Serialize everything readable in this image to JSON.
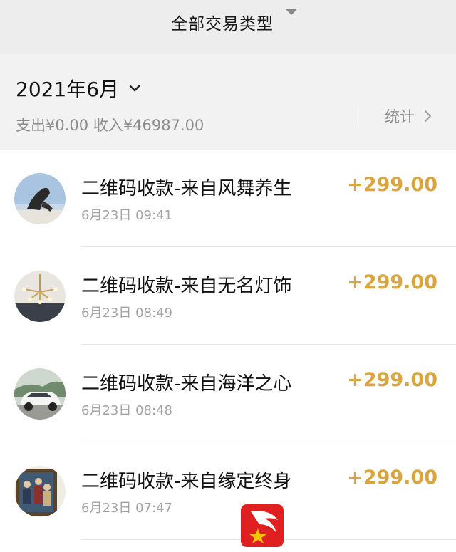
{
  "filter": {
    "label": "全部交易类型"
  },
  "month": {
    "label": "2021年6月"
  },
  "summary": {
    "expense_label": "支出",
    "expense_value": "¥0.00",
    "income_label": "收入",
    "income_value": "¥46987.00"
  },
  "stats": {
    "label": "统计"
  },
  "transactions": [
    {
      "title": "二维码收款-来自风舞养生",
      "time": "6月23日 09:41",
      "amount": "+299.00",
      "avatar": "yoga-pose-photo"
    },
    {
      "title": "二维码收款-来自无名灯饰",
      "time": "6月23日 08:49",
      "amount": "+299.00",
      "avatar": "chandelier-photo"
    },
    {
      "title": "二维码收款-来自海洋之心",
      "time": "6月23日 08:48",
      "amount": "+299.00",
      "avatar": "white-suv-photo"
    },
    {
      "title": "二维码收款-来自缘定终身",
      "time": "6月23日 07:47",
      "amount": "+299.00",
      "avatar": "painting-photo"
    }
  ],
  "colors": {
    "amount": "#d9a53f",
    "header_bg": "#ededed",
    "summary_bg": "#f2f2f2",
    "secondary_text": "#8c8c8c",
    "watermark_red": "#e02020",
    "watermark_star": "#f5c400"
  }
}
